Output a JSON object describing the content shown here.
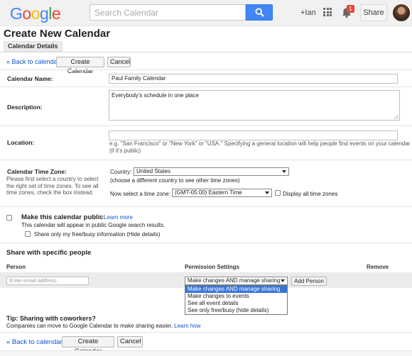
{
  "header": {
    "logo_letters": [
      {
        "ch": "G",
        "color": "#4285f4"
      },
      {
        "ch": "o",
        "color": "#ea4335"
      },
      {
        "ch": "o",
        "color": "#fbbc05"
      },
      {
        "ch": "g",
        "color": "#4285f4"
      },
      {
        "ch": "l",
        "color": "#34a853"
      },
      {
        "ch": "e",
        "color": "#ea4335"
      }
    ],
    "search_placeholder": "Search Calendar",
    "user_link": "+Ian",
    "notification_count": "1",
    "share_label": "Share"
  },
  "page": {
    "title": "Create New Calendar",
    "tab_label": "Calendar Details"
  },
  "actions": {
    "back_link": "« Back to calendar",
    "create_label": "Create Calendar",
    "cancel_label": "Cancel"
  },
  "form": {
    "name_label": "Calendar Name:",
    "name_value": "Paul Family Calendar",
    "description_label": "Description:",
    "description_value": "Everybody's schedule in one place",
    "location_label": "Location:",
    "location_value": "",
    "location_hint": "e.g. \"San Francisco\" or \"New York\" or \"USA.\" Specifying a general location will help people find events on your calendar (if it's public)",
    "timezone_label": "Calendar Time Zone:",
    "timezone_help": "Please first select a country to select the right set of time zones. To see all time zones, check the box instead.",
    "country_label": "Country:",
    "country_value": "United States",
    "country_hint": "(choose a different country to see other time zones)",
    "tz_select_label": "Now select a time zone:",
    "tz_value": "(GMT-05:00) Eastern Time",
    "display_all_label": "Display all time zones"
  },
  "public": {
    "label": "Make this calendar public",
    "learn_more": "Learn more",
    "hint": "This calendar will appear in public Google search results.",
    "freebusy_label": "Share only my free/busy information (Hide details)"
  },
  "sharing": {
    "title": "Share with specific people",
    "col_person": "Person",
    "col_permission": "Permission Settings",
    "col_remove": "Remove",
    "email_placeholder": "Enter email address",
    "permission_selected": "Make changes AND manage sharing",
    "permission_options": [
      "Make changes AND manage sharing",
      "Make changes to events",
      "See all event details",
      "See only free/busy (hide details)"
    ],
    "add_person_label": "Add Person"
  },
  "tip": {
    "title": "Tip: Sharing with coworkers?",
    "text": "Companies can move to Google Calendar to make sharing easier.",
    "link": "Learn how"
  },
  "colors": {
    "accent_blue": "#4285f4",
    "link_blue": "#1155cc",
    "badge_red": "#dd4b39",
    "dropdown_highlight": "#3875d7"
  }
}
